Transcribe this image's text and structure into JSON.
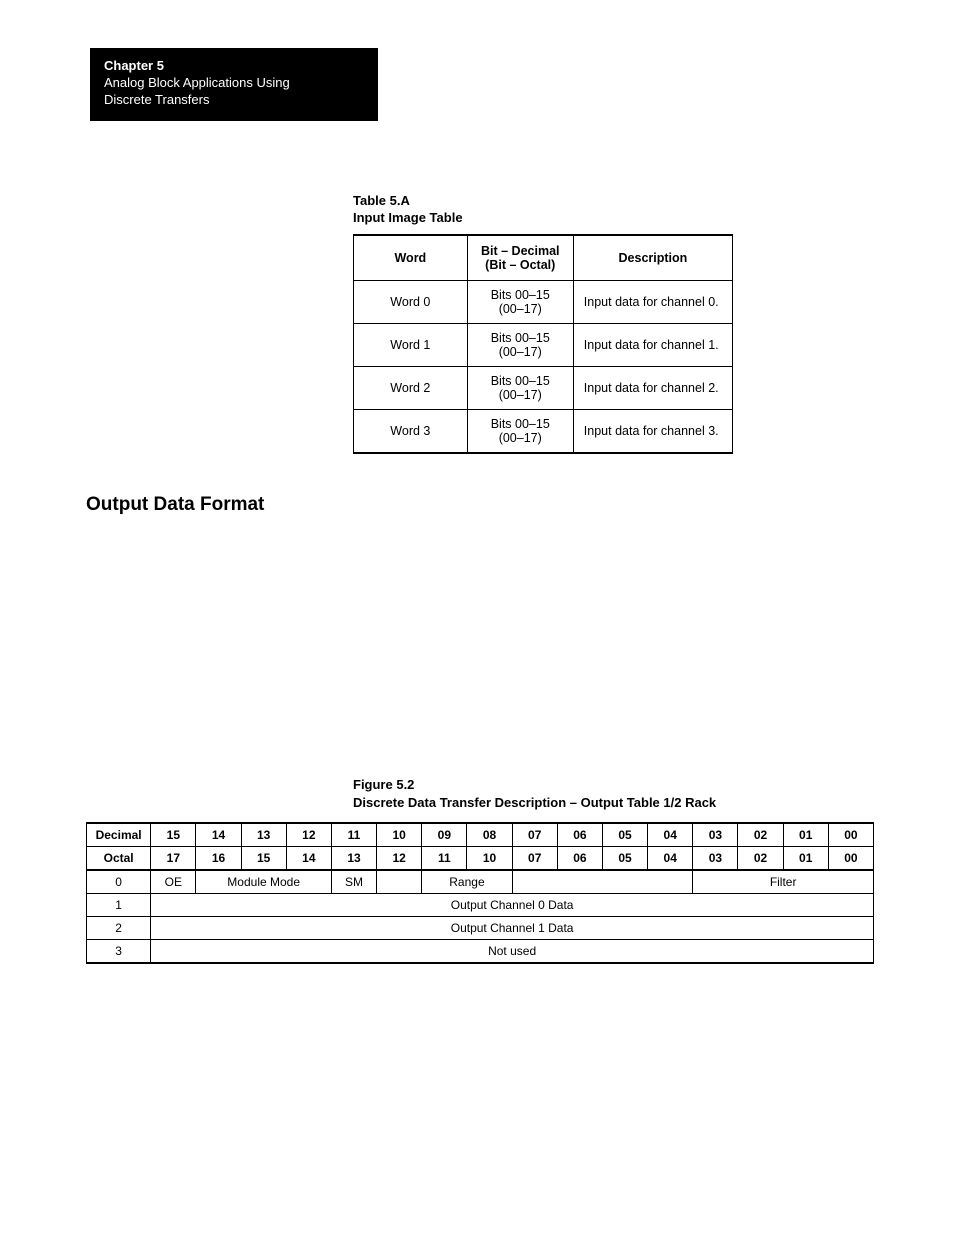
{
  "header": {
    "chapter": "Chapter 5",
    "line1": "Analog Block Applications Using",
    "line2": "Discrete Transfers"
  },
  "tableA": {
    "caption_line1": "Table 5.A",
    "caption_line2": "Input Image Table",
    "headers": {
      "word": "Word",
      "bit1": "Bit – Decimal",
      "bit2": "(Bit – Octal)",
      "desc": "Description"
    },
    "rows": [
      {
        "word": "Word 0",
        "bit1": "Bits 00–15",
        "bit2": "(00–17)",
        "desc": "Input data for channel 0."
      },
      {
        "word": "Word 1",
        "bit1": "Bits 00–15",
        "bit2": "(00–17)",
        "desc": "Input data for channel 1."
      },
      {
        "word": "Word 2",
        "bit1": "Bits 00–15",
        "bit2": "(00–17)",
        "desc": "Input data for channel 2."
      },
      {
        "word": "Word 3",
        "bit1": "Bits 00–15",
        "bit2": "(00–17)",
        "desc": "Input data for channel 3."
      }
    ]
  },
  "section_heading": "Output Data Format",
  "figure": {
    "caption_line1": "Figure 5.2",
    "caption_line2": "Discrete Data Transfer Description – Output Table 1/2 Rack",
    "decimal_label": "Decimal",
    "decimal_bits": [
      "15",
      "14",
      "13",
      "12",
      "11",
      "10",
      "09",
      "08",
      "07",
      "06",
      "05",
      "04",
      "03",
      "02",
      "01",
      "00"
    ],
    "octal_label": "Octal",
    "octal_bits": [
      "17",
      "16",
      "15",
      "14",
      "13",
      "12",
      "11",
      "10",
      "07",
      "06",
      "05",
      "04",
      "03",
      "02",
      "01",
      "00"
    ],
    "rows": [
      {
        "idx": "0",
        "cells": [
          {
            "span": 1,
            "text": "OE"
          },
          {
            "span": 3,
            "text": "Module Mode"
          },
          {
            "span": 1,
            "text": "SM"
          },
          {
            "span": 1,
            "text": ""
          },
          {
            "span": 2,
            "text": "Range"
          },
          {
            "span": 4,
            "text": ""
          },
          {
            "span": 4,
            "text": "Filter"
          }
        ]
      },
      {
        "idx": "1",
        "cells": [
          {
            "span": 16,
            "text": "Output Channel 0 Data"
          }
        ]
      },
      {
        "idx": "2",
        "cells": [
          {
            "span": 16,
            "text": "Output Channel 1 Data"
          }
        ]
      },
      {
        "idx": "3",
        "cells": [
          {
            "span": 16,
            "text": "Not used"
          }
        ]
      }
    ]
  }
}
